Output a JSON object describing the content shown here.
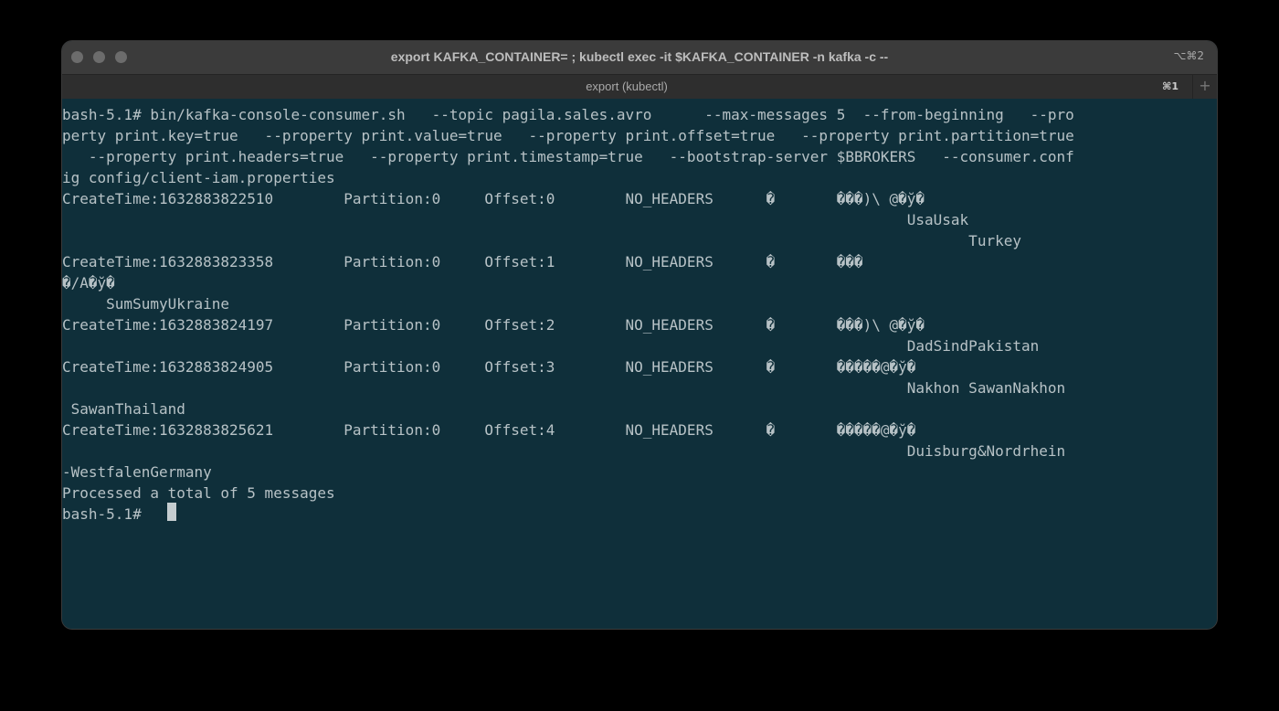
{
  "window": {
    "title": "export KAFKA_CONTAINER= ; kubectl exec -it $KAFKA_CONTAINER -n kafka -c  --",
    "shortcut": "⌥⌘2"
  },
  "tab": {
    "label": "export (kubectl)",
    "shortcut": "⌘1",
    "new_tab": "+"
  },
  "terminal": {
    "prompt": "bash-5.1#",
    "lines": [
      "bash-5.1# bin/kafka-console-consumer.sh   --topic pagila.sales.avro      --max-messages 5  --from-beginning   --pro",
      "perty print.key=true   --property print.value=true   --property print.offset=true   --property print.partition=true",
      "   --property print.headers=true   --property print.timestamp=true   --bootstrap-server $BBROKERS   --consumer.conf",
      "ig config/client-iam.properties",
      "CreateTime:1632883822510        Partition:0     Offset:0        NO_HEADERS      �       ���)\\ @�ў�",
      "                                                                                                UsaUsak",
      "                                                                                                       Turkey",
      "",
      "CreateTime:1632883823358        Partition:0     Offset:1        NO_HEADERS      �       ���",
      "�/A�ў�",
      "     SumSumyUkraine",
      "CreateTime:1632883824197        Partition:0     Offset:2        NO_HEADERS      �       ���)\\ @�ў�",
      "                                                                                                DadSindPakistan",
      "CreateTime:1632883824905        Partition:0     Offset:3        NO_HEADERS      �       �����@�ў�",
      "                                                                                                Nakhon SawanNakhon",
      " SawanThailand",
      "CreateTime:1632883825621        Partition:0     Offset:4        NO_HEADERS      �       �����@�ў�",
      "                                                                                                Duisburg&Nordrhein",
      "-WestfalenGermany",
      "Processed a total of 5 messages",
      "bash-5.1# "
    ]
  }
}
